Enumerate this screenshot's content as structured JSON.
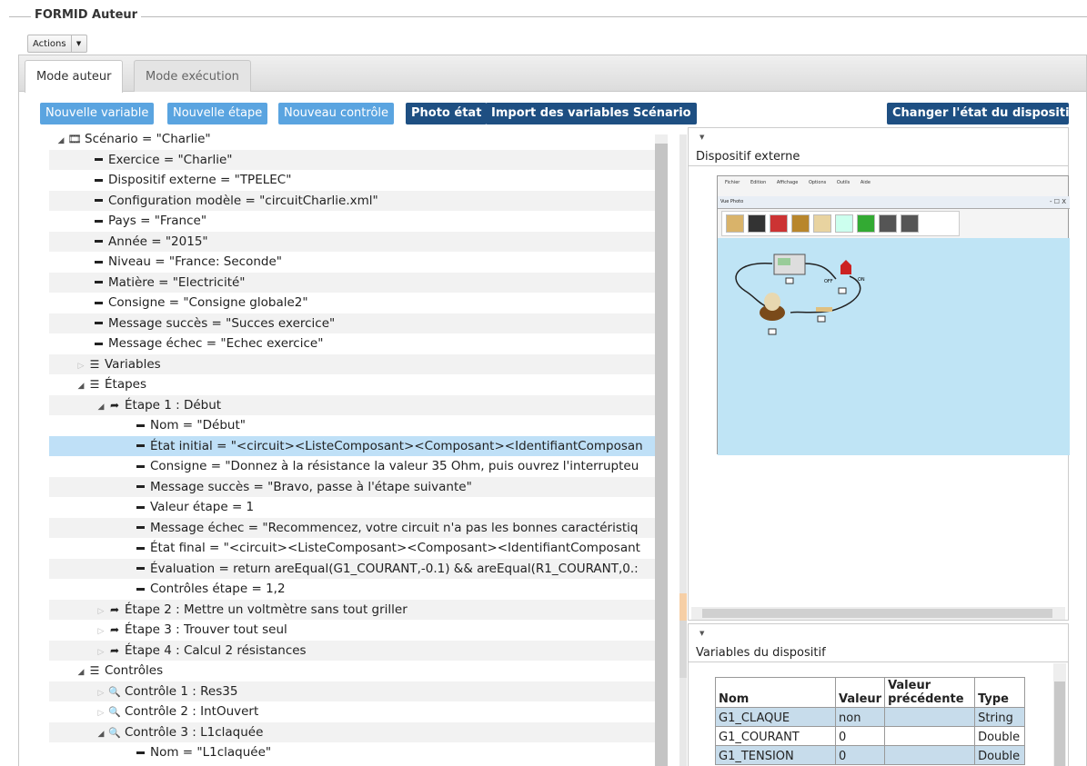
{
  "fieldset_title": "FORMID Auteur",
  "actions_label": "Actions",
  "tabs": [
    "Mode auteur",
    "Mode exécution"
  ],
  "buttons": {
    "new_variable": "Nouvelle variable",
    "new_step": "Nouvelle étape",
    "new_control": "Nouveau contrôle",
    "photo_state": "Photo état",
    "import_vars": "Import des variables Scénario",
    "change_state": "Changer l'état du dispositif"
  },
  "tree": [
    {
      "text": "Scénario = \"Charlie\"",
      "type": "scenario",
      "arrow": "open"
    },
    {
      "text": "Exercice = \"Charlie\"",
      "type": "leaf"
    },
    {
      "text": "Dispositif externe = \"TPELEC\"",
      "type": "leaf"
    },
    {
      "text": "Configuration modèle = \"circuitCharlie.xml\"",
      "type": "leaf"
    },
    {
      "text": "Pays = \"France\"",
      "type": "leaf"
    },
    {
      "text": "Année = \"2015\"",
      "type": "leaf"
    },
    {
      "text": "Niveau = \"France: Seconde\"",
      "type": "leaf"
    },
    {
      "text": "Matière = \"Electricité\"",
      "type": "leaf"
    },
    {
      "text": "Consigne = \"Consigne globale2\"",
      "type": "leaf"
    },
    {
      "text": "Message succès = \"Succes exercice\"",
      "type": "leaf"
    },
    {
      "text": "Message échec = \"Echec exercice\"",
      "type": "leaf"
    },
    {
      "text": "Variables",
      "type": "list",
      "arrow": "closed"
    },
    {
      "text": "Étapes",
      "type": "list",
      "arrow": "open"
    },
    {
      "text": "Étape 1 : Début",
      "type": "step",
      "arrow": "open"
    },
    {
      "text": "Nom = \"Début\"",
      "type": "leaf"
    },
    {
      "text": "État initial = \"<circuit><ListeComposant><Composant><IdentifiantComposan",
      "type": "leaf"
    },
    {
      "text": "Consigne = \"Donnez à la résistance la valeur 35 Ohm, puis ouvrez l'interrupteu",
      "type": "leaf"
    },
    {
      "text": "Message succès = \"Bravo, passe à l'étape suivante\"",
      "type": "leaf"
    },
    {
      "text": "Valeur étape = 1",
      "type": "leaf"
    },
    {
      "text": "Message échec = \"Recommencez, votre circuit n'a pas les bonnes caractéristiq",
      "type": "leaf"
    },
    {
      "text": "État final = \"<circuit><ListeComposant><Composant><IdentifiantComposant",
      "type": "leaf"
    },
    {
      "text": "Évaluation = return areEqual(G1_COURANT,-0.1) && areEqual(R1_COURANT,0.:",
      "type": "leaf"
    },
    {
      "text": "Contrôles étape = 1,2",
      "type": "leaf"
    },
    {
      "text": "Étape 2 : Mettre un voltmètre sans tout griller",
      "type": "step",
      "arrow": "closed"
    },
    {
      "text": "Étape 3 : Trouver tout seul",
      "type": "step",
      "arrow": "closed"
    },
    {
      "text": "Étape 4 : Calcul 2 résistances",
      "type": "step",
      "arrow": "closed"
    },
    {
      "text": "Contrôles",
      "type": "list",
      "arrow": "open"
    },
    {
      "text": "Contrôle 1 : Res35",
      "type": "control",
      "arrow": "closed"
    },
    {
      "text": "Contrôle 2 : IntOuvert",
      "type": "control",
      "arrow": "closed"
    },
    {
      "text": "Contrôle 3 : L1claquée",
      "type": "control",
      "arrow": "open"
    },
    {
      "text": "Nom = \"L1claquée\"",
      "type": "leaf"
    }
  ],
  "panel_external": {
    "title": "Dispositif externe",
    "menu": [
      "Fichier",
      "Edition",
      "Affichage",
      "Options",
      "Outils",
      "Aide"
    ],
    "window_title": "Vue Photo",
    "window_buttons": "- ☐ X",
    "labels": [
      "OFF",
      "ON"
    ]
  },
  "panel_vars": {
    "title": "Variables du dispositif",
    "headers": [
      "Nom",
      "Valeur",
      "Valeur précédente",
      "Type"
    ],
    "rows": [
      [
        "G1_CLAQUE",
        "non",
        "",
        "String"
      ],
      [
        "G1_COURANT",
        "0",
        "",
        "Double"
      ],
      [
        "G1_TENSION",
        "0",
        "",
        "Double"
      ]
    ]
  }
}
